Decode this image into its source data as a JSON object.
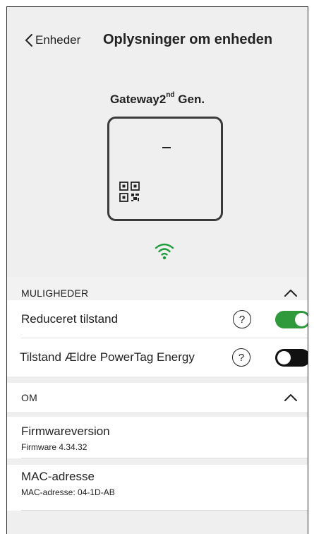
{
  "header": {
    "back_label": "Enheder",
    "title": "Oplysninger om enheden"
  },
  "device": {
    "name_prefix": "Gateway2",
    "name_sup": "nd",
    "name_suffix": " Gen.",
    "display_text": "–",
    "wifi_color": "#1a9c3a"
  },
  "sections": {
    "options": {
      "title": "MULIGHEDER",
      "items": [
        {
          "label": "Reduceret tilstand",
          "help": "?",
          "enabled": true
        },
        {
          "label": "Tilstand Ældre PowerTag Energy",
          "help": "?",
          "enabled": false
        }
      ]
    },
    "about": {
      "title": "OM",
      "items": [
        {
          "label": "Firmwareversion",
          "value": "Firmware 4.34.32"
        },
        {
          "label": "MAC-adresse",
          "value": "MAC-adresse: 04-1D-AB"
        }
      ]
    }
  },
  "colors": {
    "toggle_on": "#2e9a3c",
    "toggle_off": "#111111",
    "background": "#efefef"
  }
}
